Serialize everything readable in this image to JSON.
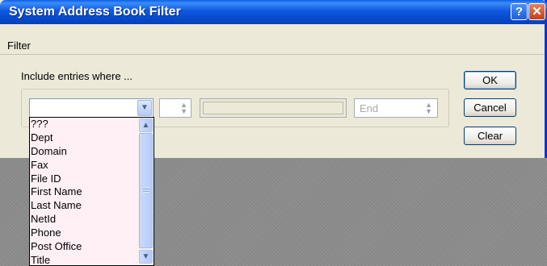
{
  "window": {
    "title": "System Address Book Filter"
  },
  "titlebar": {
    "help_label": "?",
    "close_label": "✕"
  },
  "menu": {
    "items": [
      "Filter"
    ]
  },
  "dialog": {
    "prompt": "Include entries where ...",
    "field_combo": {
      "value": "",
      "arrow": "⌄"
    },
    "operator_spin": {
      "value": ""
    },
    "value_field": {
      "value": ""
    },
    "end_spin": {
      "value": "End"
    },
    "buttons": {
      "ok": "OK",
      "cancel": "Cancel",
      "clear": "Clear"
    }
  },
  "field_dropdown": {
    "options": [
      "???",
      "Dept",
      "Domain",
      "Fax",
      "File ID",
      "First Name",
      "Last Name",
      "NetId",
      "Phone",
      "Post Office",
      "Title"
    ]
  },
  "colors": {
    "title_bar": "#0a52de",
    "dialog_bg": "#ece9d8",
    "dropdown_bg": "#fff0f5",
    "desktop": "#8c8c8c"
  }
}
